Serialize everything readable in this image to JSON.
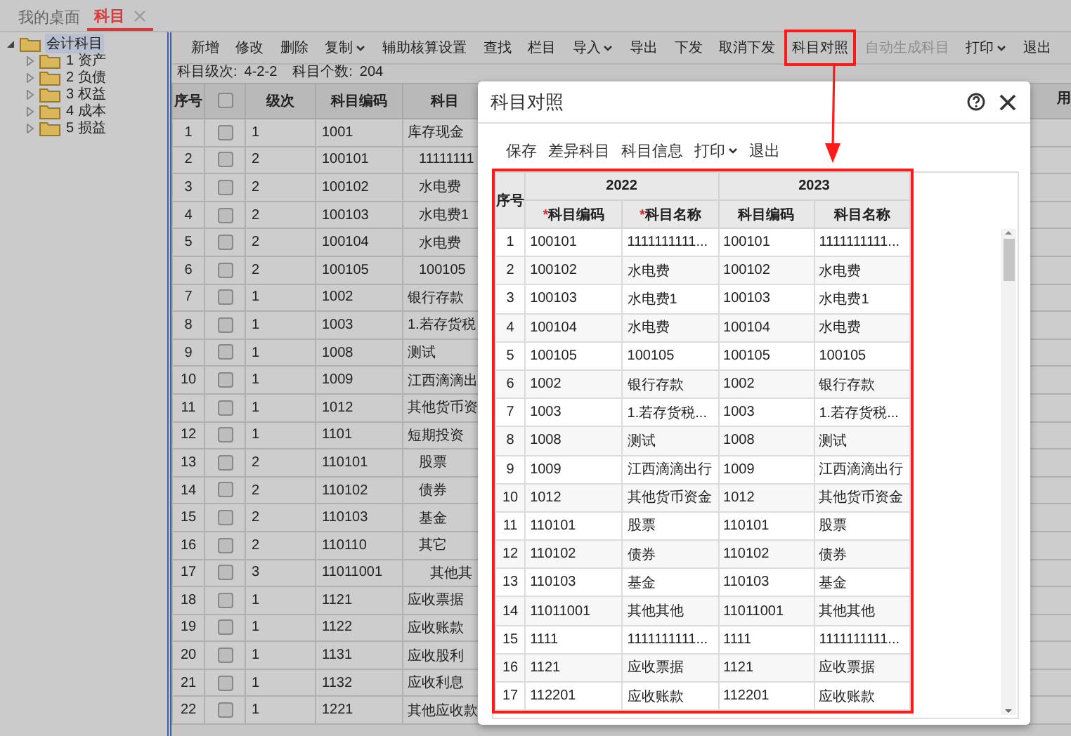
{
  "tabs": [
    {
      "label": "我的桌面",
      "selected": false,
      "closable": false
    },
    {
      "label": "科目",
      "selected": true,
      "closable": true
    }
  ],
  "tree": {
    "label": "会计科目",
    "expanded": true,
    "selected": true,
    "children": [
      {
        "label": "1 资产",
        "expanded": false
      },
      {
        "label": "2 负债",
        "expanded": false
      },
      {
        "label": "3 权益",
        "expanded": false
      },
      {
        "label": "4 成本",
        "expanded": false
      },
      {
        "label": "5 损益",
        "expanded": false
      }
    ]
  },
  "toolbar": [
    {
      "label": "新增",
      "menu": false,
      "disabled": false,
      "highlighted": false
    },
    {
      "label": "修改",
      "menu": false,
      "disabled": false,
      "highlighted": false
    },
    {
      "label": "删除",
      "menu": false,
      "disabled": false,
      "highlighted": false
    },
    {
      "label": "复制",
      "menu": true,
      "disabled": false,
      "highlighted": false
    },
    {
      "label": "辅助核算设置",
      "menu": false,
      "disabled": false,
      "highlighted": false
    },
    {
      "label": "查找",
      "menu": false,
      "disabled": false,
      "highlighted": false
    },
    {
      "label": "栏目",
      "menu": false,
      "disabled": false,
      "highlighted": false
    },
    {
      "label": "导入",
      "menu": true,
      "disabled": false,
      "highlighted": false
    },
    {
      "label": "导出",
      "menu": false,
      "disabled": false,
      "highlighted": false
    },
    {
      "label": "下发",
      "menu": false,
      "disabled": false,
      "highlighted": false
    },
    {
      "label": "取消下发",
      "menu": false,
      "disabled": false,
      "highlighted": false
    },
    {
      "label": "科目对照",
      "menu": false,
      "disabled": false,
      "highlighted": true
    },
    {
      "label": "自动生成科目",
      "menu": false,
      "disabled": true,
      "highlighted": false
    },
    {
      "label": "打印",
      "menu": true,
      "disabled": false,
      "highlighted": false
    },
    {
      "label": "退出",
      "menu": false,
      "disabled": false,
      "highlighted": false
    }
  ],
  "info": {
    "level_label": "科目级次:",
    "level_value": "4-2-2",
    "count_label": "科目个数:",
    "count_value": "204"
  },
  "table": {
    "columns": {
      "seq": "序号",
      "level": "级次",
      "code": "科目编码",
      "name": "科目",
      "last": "用"
    },
    "header_checked": false,
    "rows": [
      {
        "seq": "1",
        "checked": false,
        "level": "1",
        "code": "1001",
        "name": "库存现金"
      },
      {
        "seq": "2",
        "checked": false,
        "level": "2",
        "code": "100101",
        "name": "11111111"
      },
      {
        "seq": "3",
        "checked": false,
        "level": "2",
        "code": "100102",
        "name": "水电费"
      },
      {
        "seq": "4",
        "checked": false,
        "level": "2",
        "code": "100103",
        "name": "水电费1"
      },
      {
        "seq": "5",
        "checked": false,
        "level": "2",
        "code": "100104",
        "name": "水电费"
      },
      {
        "seq": "6",
        "checked": false,
        "level": "2",
        "code": "100105",
        "name": "100105"
      },
      {
        "seq": "7",
        "checked": false,
        "level": "1",
        "code": "1002",
        "name": "银行存款"
      },
      {
        "seq": "8",
        "checked": false,
        "level": "1",
        "code": "1003",
        "name": "1.若存货税"
      },
      {
        "seq": "9",
        "checked": false,
        "level": "1",
        "code": "1008",
        "name": "测试"
      },
      {
        "seq": "10",
        "checked": false,
        "level": "1",
        "code": "1009",
        "name": "江西滴滴出"
      },
      {
        "seq": "11",
        "checked": false,
        "level": "1",
        "code": "1012",
        "name": "其他货币资"
      },
      {
        "seq": "12",
        "checked": false,
        "level": "1",
        "code": "1101",
        "name": "短期投资"
      },
      {
        "seq": "13",
        "checked": false,
        "level": "2",
        "code": "110101",
        "name": "股票"
      },
      {
        "seq": "14",
        "checked": false,
        "level": "2",
        "code": "110102",
        "name": "债券"
      },
      {
        "seq": "15",
        "checked": false,
        "level": "2",
        "code": "110103",
        "name": "基金"
      },
      {
        "seq": "16",
        "checked": false,
        "level": "2",
        "code": "110110",
        "name": "其它"
      },
      {
        "seq": "17",
        "checked": false,
        "level": "3",
        "code": "11011001",
        "name": "其他其"
      },
      {
        "seq": "18",
        "checked": false,
        "level": "1",
        "code": "1121",
        "name": "应收票据"
      },
      {
        "seq": "19",
        "checked": false,
        "level": "1",
        "code": "1122",
        "name": "应收账款"
      },
      {
        "seq": "20",
        "checked": false,
        "level": "1",
        "code": "1131",
        "name": "应收股利"
      },
      {
        "seq": "21",
        "checked": false,
        "level": "1",
        "code": "1132",
        "name": "应收利息"
      },
      {
        "seq": "22",
        "checked": false,
        "level": "1",
        "code": "1221",
        "name": "其他应收款"
      }
    ]
  },
  "dialog": {
    "title": "科目对照",
    "toolbar": [
      {
        "label": "保存",
        "menu": false
      },
      {
        "label": "差异科目",
        "menu": false
      },
      {
        "label": "科目信息",
        "menu": false
      },
      {
        "label": "打印",
        "menu": true
      },
      {
        "label": "退出",
        "menu": false
      }
    ],
    "table": {
      "highlighted": true,
      "seq_header": "序号",
      "groups": [
        {
          "year": "2022",
          "columns": [
            {
              "mark": "*",
              "label": "科目编码"
            },
            {
              "mark": "*",
              "label": "科目名称"
            }
          ]
        },
        {
          "year": "2023",
          "columns": [
            {
              "label": "科目编码"
            },
            {
              "label": "科目名称"
            }
          ]
        }
      ],
      "rows": [
        {
          "seq": "1",
          "code_a": "100101",
          "name_a": "1111111111...",
          "code_b": "100101",
          "name_b": "1111111111..."
        },
        {
          "seq": "2",
          "code_a": "100102",
          "name_a": "水电费",
          "code_b": "100102",
          "name_b": "水电费"
        },
        {
          "seq": "3",
          "code_a": "100103",
          "name_a": "水电费1",
          "code_b": "100103",
          "name_b": "水电费1"
        },
        {
          "seq": "4",
          "code_a": "100104",
          "name_a": "水电费",
          "code_b": "100104",
          "name_b": "水电费"
        },
        {
          "seq": "5",
          "code_a": "100105",
          "name_a": "100105",
          "code_b": "100105",
          "name_b": "100105"
        },
        {
          "seq": "6",
          "code_a": "1002",
          "name_a": "银行存款",
          "code_b": "1002",
          "name_b": "银行存款"
        },
        {
          "seq": "7",
          "code_a": "1003",
          "name_a": "1.若存货税...",
          "code_b": "1003",
          "name_b": "1.若存货税..."
        },
        {
          "seq": "8",
          "code_a": "1008",
          "name_a": "测试",
          "code_b": "1008",
          "name_b": "测试"
        },
        {
          "seq": "9",
          "code_a": "1009",
          "name_a": "江西滴滴出行",
          "code_b": "1009",
          "name_b": "江西滴滴出行"
        },
        {
          "seq": "10",
          "code_a": "1012",
          "name_a": "其他货币资金",
          "code_b": "1012",
          "name_b": "其他货币资金"
        },
        {
          "seq": "11",
          "code_a": "110101",
          "name_a": "股票",
          "code_b": "110101",
          "name_b": "股票"
        },
        {
          "seq": "12",
          "code_a": "110102",
          "name_a": "债券",
          "code_b": "110102",
          "name_b": "债券"
        },
        {
          "seq": "13",
          "code_a": "110103",
          "name_a": "基金",
          "code_b": "110103",
          "name_b": "基金"
        },
        {
          "seq": "14",
          "code_a": "11011001",
          "name_a": "其他其他",
          "code_b": "11011001",
          "name_b": "其他其他"
        },
        {
          "seq": "15",
          "code_a": "1111",
          "name_a": "1111111111...",
          "code_b": "1111",
          "name_b": "1111111111..."
        },
        {
          "seq": "16",
          "code_a": "1121",
          "name_a": "应收票据",
          "code_b": "1121",
          "name_b": "应收票据"
        },
        {
          "seq": "17",
          "code_a": "112201",
          "name_a": "应收账款",
          "code_b": "112201",
          "name_b": "应收账款"
        }
      ]
    }
  }
}
